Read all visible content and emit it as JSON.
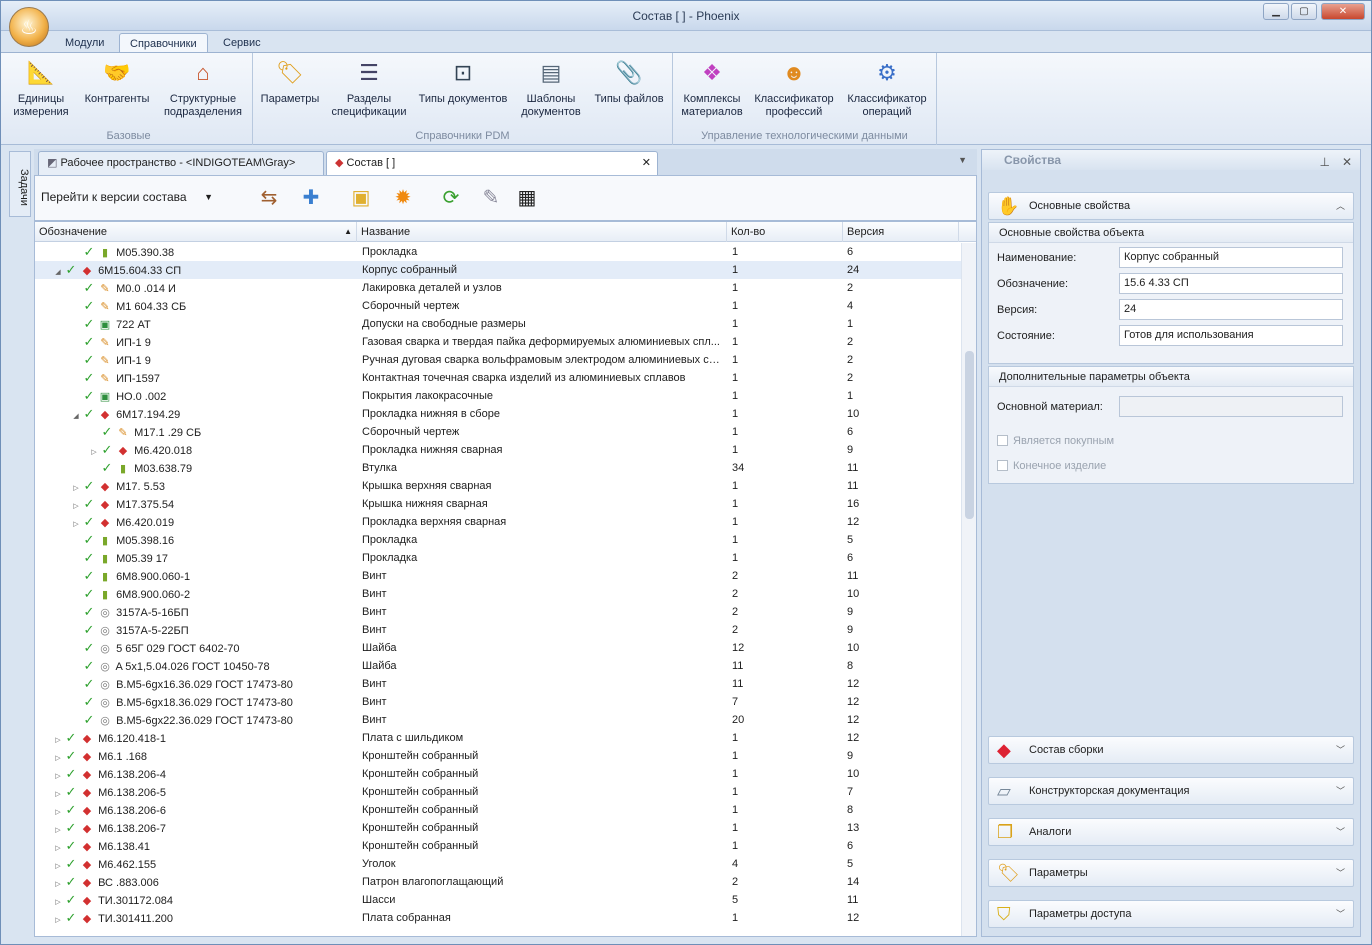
{
  "window": {
    "title": "Состав [                                        ] - Phoenix",
    "min": "▁",
    "max": "▢",
    "close": "✕"
  },
  "ribbon_tabs": [
    "Модули",
    "Справочники",
    "Сервис"
  ],
  "ribbon": {
    "groups": [
      {
        "name": "Базовые",
        "buttons": [
          {
            "label": "Единицы измерения",
            "icon": "ruler-triangle-icon"
          },
          {
            "label": "Контрагенты",
            "icon": "handshake-icon"
          },
          {
            "label": "Структурные подразделения",
            "icon": "house-icon"
          }
        ]
      },
      {
        "name": "Справочники PDM",
        "buttons": [
          {
            "label": "Параметры",
            "icon": "tag-icon"
          },
          {
            "label": "Разделы спецификации",
            "icon": "spec-section-icon"
          },
          {
            "label": "Типы документов",
            "icon": "document-type-icon"
          },
          {
            "label": "Шаблоны документов",
            "icon": "document-template-icon"
          },
          {
            "label": "Типы файлов",
            "icon": "paperclip-icon"
          }
        ]
      },
      {
        "name": "Управление технологическими данными",
        "buttons": [
          {
            "label": "Комплексы материалов",
            "icon": "cubes-icon"
          },
          {
            "label": "Классификатор профессий",
            "icon": "worker-icon"
          },
          {
            "label": "Классификатор операций",
            "icon": "gears-icon"
          }
        ]
      }
    ]
  },
  "left_strip": {
    "label": "Задачи"
  },
  "doc_tabs": [
    {
      "label": "Рабочее пространство - <INDIGOTEAM\\Gray>",
      "close": "✕"
    },
    {
      "label": "Состав [                          ]",
      "close": "✕"
    }
  ],
  "toolbar": {
    "version_select": "Перейти к версии состава",
    "dropdown": "▼",
    "overflow": "▼"
  },
  "grid": {
    "columns": [
      "Обозначение",
      "Название",
      "Кол-во",
      "Версия"
    ],
    "sort_indicator": "▲",
    "rows": [
      {
        "indent": 2,
        "tri": "",
        "icon": "part",
        "code": "M05.390.38",
        "name": "Прокладка",
        "qty": "1",
        "ver": "6"
      },
      {
        "indent": 1,
        "tri": "◢",
        "icon": "assembly",
        "code": "6M15.604.33 СП",
        "name": "Корпус собранный",
        "qty": "1",
        "ver": "24",
        "selected": true
      },
      {
        "indent": 2,
        "tri": "",
        "icon": "doc",
        "code": "M0.0  .014 И",
        "name": "Лакировка деталей и узлов",
        "qty": "1",
        "ver": "2"
      },
      {
        "indent": 2,
        "tri": "",
        "icon": "doc",
        "code": "M1   604.33 СБ",
        "name": "Сборочный чертеж",
        "qty": "1",
        "ver": "4"
      },
      {
        "indent": 2,
        "tri": "",
        "icon": "greendoc",
        "code": "722 АТ",
        "name": "Допуски на свободные размеры",
        "qty": "1",
        "ver": "1"
      },
      {
        "indent": 2,
        "tri": "",
        "icon": "doc",
        "code": "ИП-1  9",
        "name": "Газовая сварка и твердая пайка деформируемых алюминиевых спл...",
        "qty": "1",
        "ver": "2"
      },
      {
        "indent": 2,
        "tri": "",
        "icon": "doc",
        "code": "ИП-1  9",
        "name": "Ручная дуговая сварка вольфрамовым электродом алюминиевых сп...",
        "qty": "1",
        "ver": "2"
      },
      {
        "indent": 2,
        "tri": "",
        "icon": "doc",
        "code": "ИП-1597",
        "name": "Контактная точечная сварка изделий из алюминиевых сплавов",
        "qty": "1",
        "ver": "2"
      },
      {
        "indent": 2,
        "tri": "",
        "icon": "greendoc",
        "code": "НО.0  .002",
        "name": "Покрытия лакокрасочные",
        "qty": "1",
        "ver": "1"
      },
      {
        "indent": 2,
        "tri": "◢",
        "icon": "assembly",
        "code": "6M17.194.29",
        "name": "Прокладка нижняя в сборе",
        "qty": "1",
        "ver": "10"
      },
      {
        "indent": 3,
        "tri": "",
        "icon": "doc",
        "code": "M17.1  .29 СБ",
        "name": "Сборочный чертеж",
        "qty": "1",
        "ver": "6"
      },
      {
        "indent": 3,
        "tri": "▷",
        "icon": "assembly",
        "code": "M6.420.018",
        "name": "Прокладка нижняя сварная",
        "qty": "1",
        "ver": "9"
      },
      {
        "indent": 3,
        "tri": "",
        "icon": "part",
        "code": "M03.638.79",
        "name": "Втулка",
        "qty": "34",
        "ver": "11"
      },
      {
        "indent": 2,
        "tri": "▷",
        "icon": "assembly",
        "code": "M17.  5.53",
        "name": "Крышка верхняя сварная",
        "qty": "1",
        "ver": "11"
      },
      {
        "indent": 2,
        "tri": "▷",
        "icon": "assembly",
        "code": "M17.375.54",
        "name": "Крышка нижняя сварная",
        "qty": "1",
        "ver": "16"
      },
      {
        "indent": 2,
        "tri": "▷",
        "icon": "assembly",
        "code": "M6.420.019",
        "name": "Прокладка верхняя сварная",
        "qty": "1",
        "ver": "12"
      },
      {
        "indent": 2,
        "tri": "",
        "icon": "part",
        "code": "M05.398.16",
        "name": "Прокладка",
        "qty": "1",
        "ver": "5"
      },
      {
        "indent": 2,
        "tri": "",
        "icon": "part",
        "code": "M05.39  17",
        "name": "Прокладка",
        "qty": "1",
        "ver": "6"
      },
      {
        "indent": 2,
        "tri": "",
        "icon": "part",
        "code": "6M8.900.060-1",
        "name": "Винт",
        "qty": "2",
        "ver": "11"
      },
      {
        "indent": 2,
        "tri": "",
        "icon": "part",
        "code": "6M8.900.060-2",
        "name": "Винт",
        "qty": "2",
        "ver": "10"
      },
      {
        "indent": 2,
        "tri": "",
        "icon": "std",
        "code": "3157A-5-16БП",
        "name": "Винт",
        "qty": "2",
        "ver": "9"
      },
      {
        "indent": 2,
        "tri": "",
        "icon": "std",
        "code": "3157A-5-22БП",
        "name": "Винт",
        "qty": "2",
        "ver": "9"
      },
      {
        "indent": 2,
        "tri": "",
        "icon": "std",
        "code": "5 65Г 029 ГОСТ 6402-70",
        "name": "Шайба",
        "qty": "12",
        "ver": "10"
      },
      {
        "indent": 2,
        "tri": "",
        "icon": "std",
        "code": "A 5x1,5.04.026 ГОСТ 10450-78",
        "name": "Шайба",
        "qty": "11",
        "ver": "8"
      },
      {
        "indent": 2,
        "tri": "",
        "icon": "std",
        "code": "B.M5-6gx16.36.029 ГОСТ 17473-80",
        "name": "Винт",
        "qty": "11",
        "ver": "12"
      },
      {
        "indent": 2,
        "tri": "",
        "icon": "std",
        "code": "B.M5-6gx18.36.029 ГОСТ 17473-80",
        "name": "Винт",
        "qty": "7",
        "ver": "12"
      },
      {
        "indent": 2,
        "tri": "",
        "icon": "std",
        "code": "B.M5-6gx22.36.029 ГОСТ 17473-80",
        "name": "Винт",
        "qty": "20",
        "ver": "12"
      },
      {
        "indent": 1,
        "tri": "▷",
        "icon": "assembly",
        "code": "M6.120.418-1",
        "name": "Плата с шильдиком",
        "qty": "1",
        "ver": "12"
      },
      {
        "indent": 1,
        "tri": "▷",
        "icon": "assembly",
        "code": "M6.1  .168",
        "name": "Кронштейн собранный",
        "qty": "1",
        "ver": "9"
      },
      {
        "indent": 1,
        "tri": "▷",
        "icon": "assembly",
        "code": "M6.138.206-4",
        "name": "Кронштейн собранный",
        "qty": "1",
        "ver": "10"
      },
      {
        "indent": 1,
        "tri": "▷",
        "icon": "assembly",
        "code": "M6.138.206-5",
        "name": "Кронштейн собранный",
        "qty": "1",
        "ver": "7"
      },
      {
        "indent": 1,
        "tri": "▷",
        "icon": "assembly",
        "code": "M6.138.206-6",
        "name": "Кронштейн собранный",
        "qty": "1",
        "ver": "8"
      },
      {
        "indent": 1,
        "tri": "▷",
        "icon": "assembly",
        "code": "M6.138.206-7",
        "name": "Кронштейн собранный",
        "qty": "1",
        "ver": "13"
      },
      {
        "indent": 1,
        "tri": "▷",
        "icon": "assembly",
        "code": "M6.138.41",
        "name": "Кронштейн собранный",
        "qty": "1",
        "ver": "6"
      },
      {
        "indent": 1,
        "tri": "▷",
        "icon": "assembly",
        "code": "M6.462.155",
        "name": "Уголок",
        "qty": "4",
        "ver": "5"
      },
      {
        "indent": 1,
        "tri": "▷",
        "icon": "assembly",
        "code": "ВС  .883.006",
        "name": "Патрон влагопоглащающий",
        "qty": "2",
        "ver": "14"
      },
      {
        "indent": 1,
        "tri": "▷",
        "icon": "assembly",
        "code": "ТИ.301172.084",
        "name": "Шасси",
        "qty": "5",
        "ver": "11"
      },
      {
        "indent": 1,
        "tri": "▷",
        "icon": "assembly",
        "code": "ТИ.301411.200",
        "name": "Плата собранная",
        "qty": "1",
        "ver": "12"
      }
    ]
  },
  "props": {
    "title": "Свойства",
    "pin": "⊥",
    "close": "✕",
    "main_section": "Основные свойства",
    "object_box": "Основные свойства объекта",
    "fields": [
      {
        "label": "Наименование:",
        "value": "Корпус собранный"
      },
      {
        "label": "Обозначение:",
        "value": "15.6   4.33 СП"
      },
      {
        "label": "Версия:",
        "value": "24"
      },
      {
        "label": "Состояние:",
        "value": "Готов для использования"
      }
    ],
    "extra_box": "Дополнительные параметры объекта",
    "material_label": "Основной материал:",
    "material_value": "",
    "checkbox_purchased": "Является покупным",
    "checkbox_final": "Конечное изделие",
    "sections": [
      "Состав сборки",
      "Конструкторская документация",
      "Аналоги",
      "Параметры",
      "Параметры доступа"
    ]
  }
}
